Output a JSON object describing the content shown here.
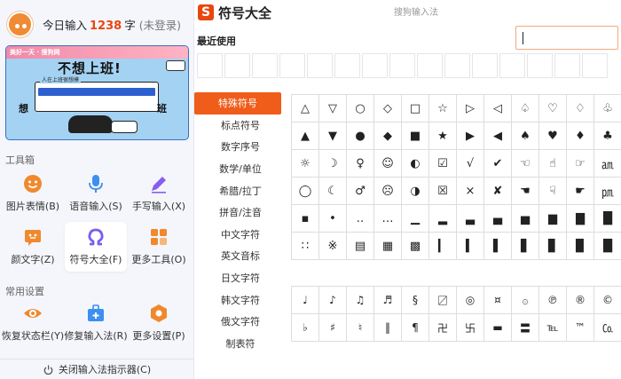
{
  "header": {
    "today_label": "今日输入",
    "count": "1238",
    "unit": "字",
    "status": "(未登录)"
  },
  "banner": {
    "tag": "美好一天 · 搜狗网",
    "slogan": "不想上班!",
    "card_title": "人在上班很想摸",
    "side_left": "想",
    "side_right": "班"
  },
  "toolbox": {
    "title": "工具箱",
    "items": [
      {
        "label": "图片表情(B)",
        "icon": "smile-icon"
      },
      {
        "label": "语音输入(S)",
        "icon": "microphone-icon"
      },
      {
        "label": "手写输入(X)",
        "icon": "pen-icon"
      },
      {
        "label": "颜文字(Z)",
        "icon": "emoticon-icon"
      },
      {
        "label": "符号大全(F)",
        "icon": "omega-icon"
      },
      {
        "label": "更多工具(O)",
        "icon": "grid-icon"
      }
    ]
  },
  "settings": {
    "title": "常用设置",
    "items": [
      {
        "label": "恢复状态栏(Y)",
        "icon": "eye-icon"
      },
      {
        "label": "修复输入法(R)",
        "icon": "toolbox-icon"
      },
      {
        "label": "更多设置(P)",
        "icon": "hex-gear-icon"
      }
    ]
  },
  "bottom_label": "关闭输入法指示器(C)",
  "app": {
    "logo_letter": "S",
    "title": "符号大全",
    "window_title": "搜狗输入法",
    "recent_label": "最近使用"
  },
  "categories": [
    "特殊符号",
    "标点符号",
    "数字序号",
    "数学/单位",
    "希腊/拉丁",
    "拼音/注音",
    "中文字符",
    "英文音标",
    "日文字符",
    "韩文字符",
    "俄文字符",
    "制表符"
  ],
  "selected_category": "特殊符号",
  "symbols_main": [
    [
      "△",
      "▽",
      "○",
      "◇",
      "□",
      "☆",
      "▷",
      "◁",
      "♤",
      "♡",
      "♢",
      "♧"
    ],
    [
      "▲",
      "▼",
      "●",
      "◆",
      "■",
      "★",
      "▶",
      "◀",
      "♠",
      "♥",
      "♦",
      "♣"
    ],
    [
      "☼",
      "☽",
      "♀",
      "☺",
      "◐",
      "☑",
      "√",
      "✔",
      "☜",
      "☝",
      "☞",
      "㏂"
    ],
    [
      "◯",
      "☾",
      "♂",
      "☹",
      "◑",
      "☒",
      "×",
      "✘",
      "☚",
      "☟",
      "☛",
      "㏘"
    ],
    [
      "▪",
      "•",
      "‥",
      "…",
      "▁",
      "▂",
      "▃",
      "▄",
      "▅",
      "▆",
      "▇",
      "█"
    ],
    [
      "∷",
      "※",
      "▤",
      "▦",
      "▩",
      "▎",
      "▍",
      "▌",
      "▋",
      "▊",
      "▉",
      "█"
    ]
  ],
  "symbols_music": [
    [
      "♩",
      "♪",
      "♫",
      "♬",
      "§",
      "〼",
      "◎",
      "¤",
      "۞",
      "℗",
      "®",
      "©"
    ],
    [
      "♭",
      "♯",
      "♮",
      "‖",
      "¶",
      "卍",
      "卐",
      "▬",
      "〓",
      "℡",
      "™",
      "㏇"
    ]
  ],
  "colors": {
    "accent": "#f05c1a",
    "count": "#e8470f"
  }
}
